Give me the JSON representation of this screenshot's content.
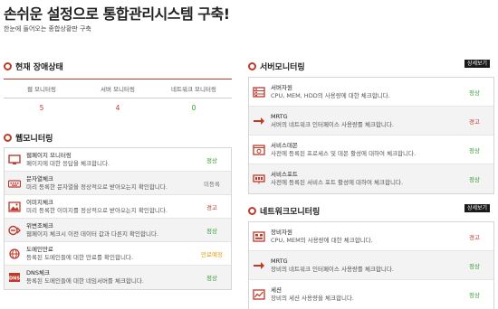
{
  "header": {
    "title": "손쉬운 설정으로 통합관리시스템 구축!",
    "subtitle": "한눈에 들어오는 종합상황판 구축"
  },
  "colors": {
    "accent": "#c0392b",
    "ok": "#2e9a2e",
    "warning": "#c0392b",
    "pending": "#e0a010"
  },
  "current_status": {
    "title": "현재 장애상태",
    "columns": [
      "웹 모니터링",
      "서버 모니터링",
      "네트워크 모니터링"
    ],
    "values": [
      "5",
      "4",
      "0"
    ],
    "value_colors": [
      "#c0392b",
      "#c0392b",
      "#2e9a2e"
    ]
  },
  "web_monitoring": {
    "title": "웹모니터링",
    "items": [
      {
        "icon": "monitor-icon",
        "title": "웹페이지 모니터링",
        "desc": "페이지에 대한 응답을 체크합니다.",
        "status": "정상"
      },
      {
        "icon": "keyboard-icon",
        "title": "문자열체크",
        "desc": "미리 등록한 문자열을 정상적으로 받아오는지 확인합니다.",
        "status": "미등록"
      },
      {
        "icon": "image-icon",
        "title": "이미지체크",
        "desc": "미리 등록한 이미지를 정상적으로 받아오는지 확인합니다.",
        "status": "경고"
      },
      {
        "icon": "tamper-icon",
        "title": "위변조체크",
        "desc": "웹페이지 체크시 이전 데이터 값과 다른지 확인합니다.",
        "status": "정상"
      },
      {
        "icon": "globe-icon",
        "title": "도메인만료",
        "desc": "등록된 도메인들에 대한 만료를 확인합니다.",
        "status": "만료예정"
      },
      {
        "icon": "dns-icon",
        "title": "DNS체크",
        "desc": "등록된 도메인들에 대한 네임서버를 체크합니다.",
        "status": "정상"
      }
    ]
  },
  "server_monitoring": {
    "title": "서버모니터링",
    "more": "상세보기",
    "items": [
      {
        "icon": "server-icon",
        "title": "서버자원",
        "desc": "CPU, MEM, HDD의 사용량에 대한 체크합니다.",
        "status": "정상"
      },
      {
        "icon": "mrtg-icon",
        "title": "MRTG",
        "desc": "서버의 네트워크 인터페이스 사용량를 체크합니다.",
        "status": "경고"
      },
      {
        "icon": "daemon-icon",
        "title": "서비스데몬",
        "desc": "사전에 등록된 프로세스 및 데몬 활성에 대하여 체크합니다.",
        "status": "정상"
      },
      {
        "icon": "port-icon",
        "title": "서비스포트",
        "desc": "사전에 등록된 서비스 포트 활성에 대하여 체크합니다.",
        "status": "정상"
      }
    ]
  },
  "network_monitoring": {
    "title": "네트워크모니터링",
    "more": "상세보기",
    "items": [
      {
        "icon": "device-icon",
        "title": "장비자원",
        "desc": "CPU, MEM의 사용량에 대한 체크합니다.",
        "status": "경고"
      },
      {
        "icon": "mrtg-icon",
        "title": "MRTG",
        "desc": "장비의 네트워크 인터페이스 사용량를 체크합니다.",
        "status": "정상"
      },
      {
        "icon": "session-icon",
        "title": "세션",
        "desc": "장비의 세션 사용량을 체크합니다.",
        "status": "정상"
      }
    ]
  }
}
